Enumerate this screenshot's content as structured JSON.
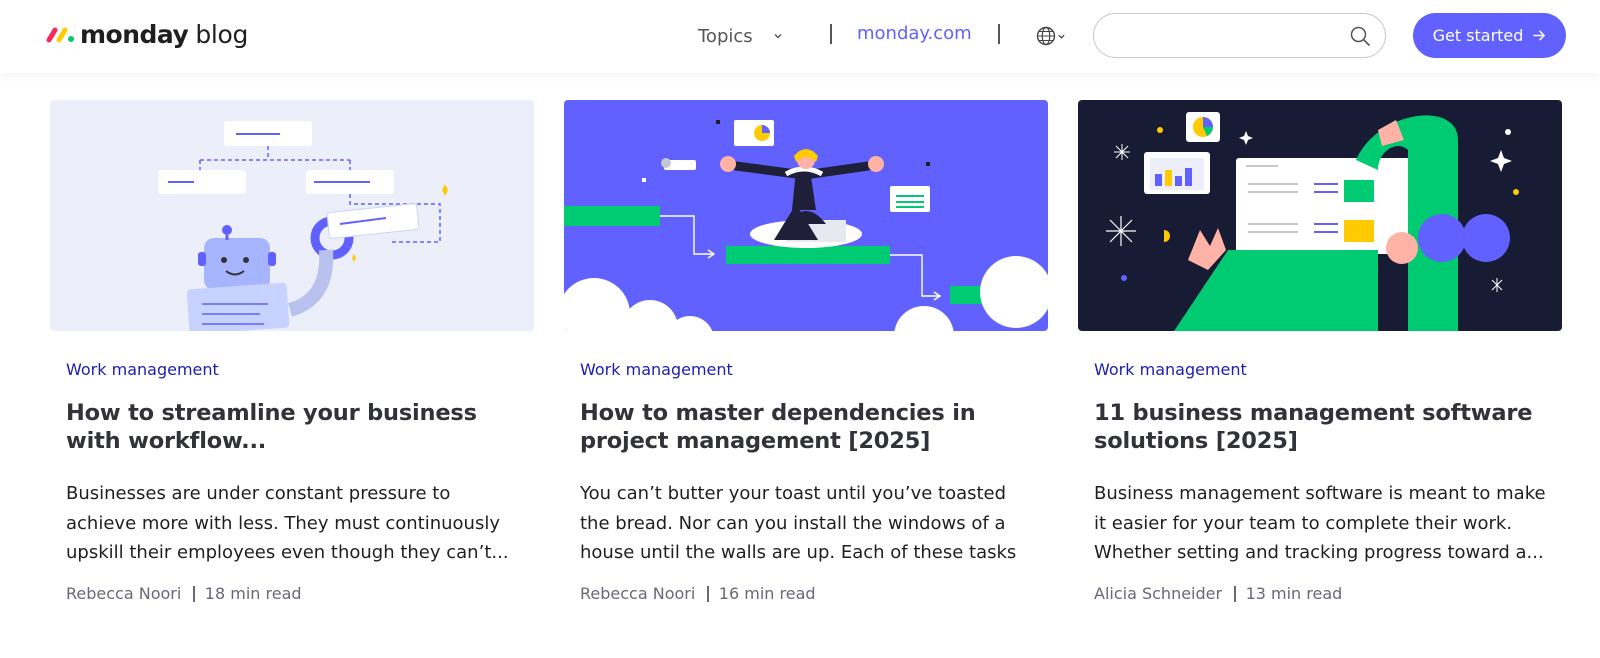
{
  "header": {
    "logo_text": "monday",
    "logo_suffix": "blog",
    "topics_label": "Topics",
    "site_link": "monday.com",
    "search_placeholder": "",
    "cta_label": "Get started"
  },
  "colors": {
    "brand_purple": "#6161ff",
    "tag_blue": "#1d1dad",
    "logo_red": "#fb275d",
    "logo_yellow": "#ffcc00",
    "logo_green": "#00ca72"
  },
  "posts": [
    {
      "category": "Work management",
      "title": "How to streamline your business with workflow...",
      "excerpt": "Businesses are under constant pressure to achieve more with less. They must continuously upskill their employees even though they can’t...",
      "author": "Rebecca Noori",
      "read_time": "18 min read",
      "image": "workflow-robot-illustration"
    },
    {
      "category": "Work management",
      "title": "How to master dependencies in project management [2025]",
      "excerpt": "You can’t butter your toast until you’ve toasted the bread. Nor can you install the windows of a house until the walls are up. Each of these tasks is...",
      "author": "Rebecca Noori",
      "read_time": "16 min read",
      "image": "meditating-person-illustration"
    },
    {
      "category": "Work management",
      "title": "11 business management software solutions [2025]",
      "excerpt": "Business management software is meant to make it easier for your team to complete their work. Whether setting and tracking progress toward a...",
      "author": "Alicia Schneider",
      "read_time": "13 min read",
      "image": "dashboard-hands-illustration"
    }
  ]
}
